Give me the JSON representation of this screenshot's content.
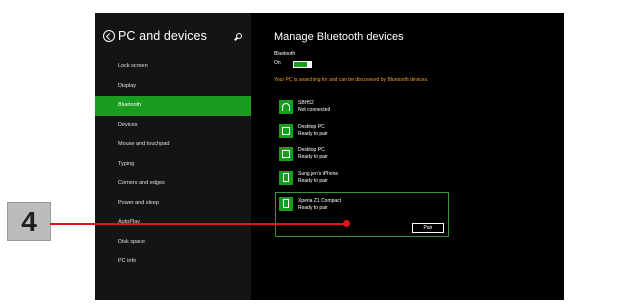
{
  "sidebar": {
    "title": "PC and devices",
    "items": [
      {
        "label": "Lock screen"
      },
      {
        "label": "Display"
      },
      {
        "label": "Bluetooth"
      },
      {
        "label": "Devices"
      },
      {
        "label": "Mouse and touchpad"
      },
      {
        "label": "Typing"
      },
      {
        "label": "Corners and edges"
      },
      {
        "label": "Power and sleep"
      },
      {
        "label": "AutoPlay"
      },
      {
        "label": "Disk space"
      },
      {
        "label": "PC info"
      }
    ],
    "active_index": 2
  },
  "main": {
    "title": "Manage Bluetooth devices",
    "bluetooth_label": "Bluetooth",
    "bluetooth_state": "On",
    "status": "Your PC is searching for and can be discovered by Bluetooth devices.",
    "devices": [
      {
        "name": "SBH52",
        "status": "Not connected",
        "icon": "headphones-icon"
      },
      {
        "name": "Desktop PC",
        "status": "Ready to pair",
        "icon": "computer-icon"
      },
      {
        "name": "Desktop PC",
        "status": "Ready to pair",
        "icon": "computer-icon"
      },
      {
        "name": "Sung.jen's iPhone",
        "status": "Ready to pair",
        "icon": "phone-icon"
      }
    ],
    "selected_device": {
      "name": "Xperia Z1 Compact",
      "status": "Ready to pair",
      "icon": "phone-icon"
    },
    "pair_label": "Pair"
  },
  "callout": {
    "number": "4"
  },
  "colors": {
    "accent": "#1a9d1f",
    "callout": "#e0151b",
    "status": "#f0a030"
  }
}
